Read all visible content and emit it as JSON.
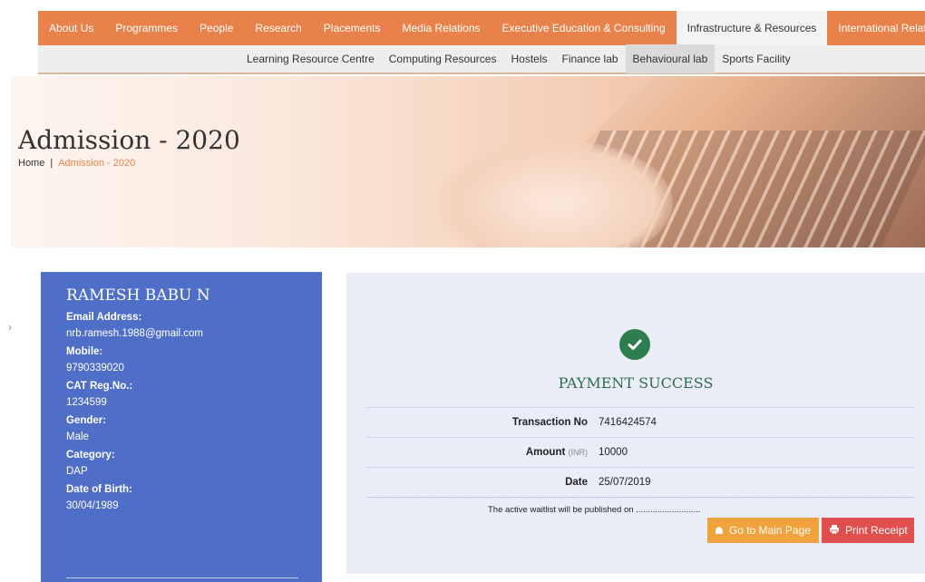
{
  "nav": {
    "items": [
      "About Us",
      "Programmes",
      "People",
      "Research",
      "Placements",
      "Media Relations",
      "Executive Education & Consulting",
      "Infrastructure & Resources",
      "International Relations"
    ],
    "active": "Infrastructure & Resources"
  },
  "subnav": {
    "items": [
      "Learning Resource Centre",
      "Computing Resources",
      "Hostels",
      "Finance lab",
      "Behavioural lab",
      "Sports Facility"
    ],
    "active": "Behavioural lab"
  },
  "banner": {
    "title": "Admission - 2020",
    "breadcrumb": {
      "home": "Home",
      "separator": "|",
      "current": "Admission - 2020"
    }
  },
  "side_arrow": "›",
  "profile": {
    "name": "RAMESH BABU N",
    "fields": [
      {
        "label": "Email Address:",
        "value": "nrb.ramesh.1988@gmail.com"
      },
      {
        "label": "Mobile:",
        "value": "9790339020"
      },
      {
        "label": "CAT Reg.No.:",
        "value": "1234599"
      },
      {
        "label": "Gender:",
        "value": "Male"
      },
      {
        "label": "Category:",
        "value": "DAP"
      },
      {
        "label": "Date of Birth:",
        "value": "30/04/1989"
      }
    ]
  },
  "payment": {
    "status": "PAYMENT SUCCESS",
    "transaction_label": "Transaction No",
    "transaction_no": "7416424574",
    "amount_label": "Amount",
    "amount_unit": "(INR)",
    "amount": "10000",
    "date_label": "Date",
    "date": "25/07/2019",
    "note": "The active waitlist will be published on ...........................",
    "main_button": "Go to Main Page",
    "print_button": "Print Receipt"
  },
  "icons": {
    "check": "check-circle-icon",
    "home": "home-icon",
    "print": "print-icon"
  },
  "colors": {
    "nav": "#e8824a",
    "profile": "#4f6ec8",
    "success": "#2e7d4f",
    "main_btn": "#f0a33c",
    "print_btn": "#e04e4e"
  }
}
